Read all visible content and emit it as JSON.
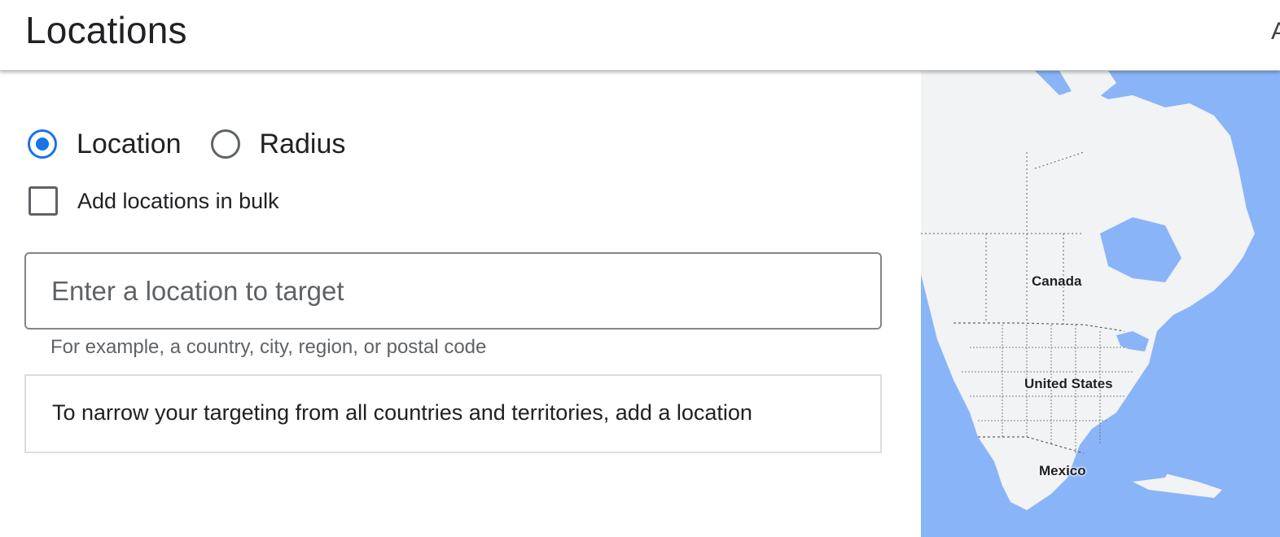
{
  "header": {
    "title": "Locations",
    "edge_glyph": "A"
  },
  "targeting": {
    "options": [
      {
        "label": "Location",
        "selected": true
      },
      {
        "label": "Radius",
        "selected": false
      }
    ],
    "bulk": {
      "label": "Add locations in bulk",
      "checked": false
    }
  },
  "search": {
    "value": "",
    "placeholder": "Enter a location to target",
    "helper": "For example, a country, city, region, or postal code"
  },
  "notice": {
    "text": "To narrow your targeting from all countries and territories, add a location"
  },
  "map": {
    "labels": {
      "canada": "Canada",
      "united_states": "United States",
      "mexico": "Mexico"
    },
    "colors": {
      "water": "#8ab4f8",
      "land": "#f1f3f4",
      "border": "#5f6368"
    }
  }
}
